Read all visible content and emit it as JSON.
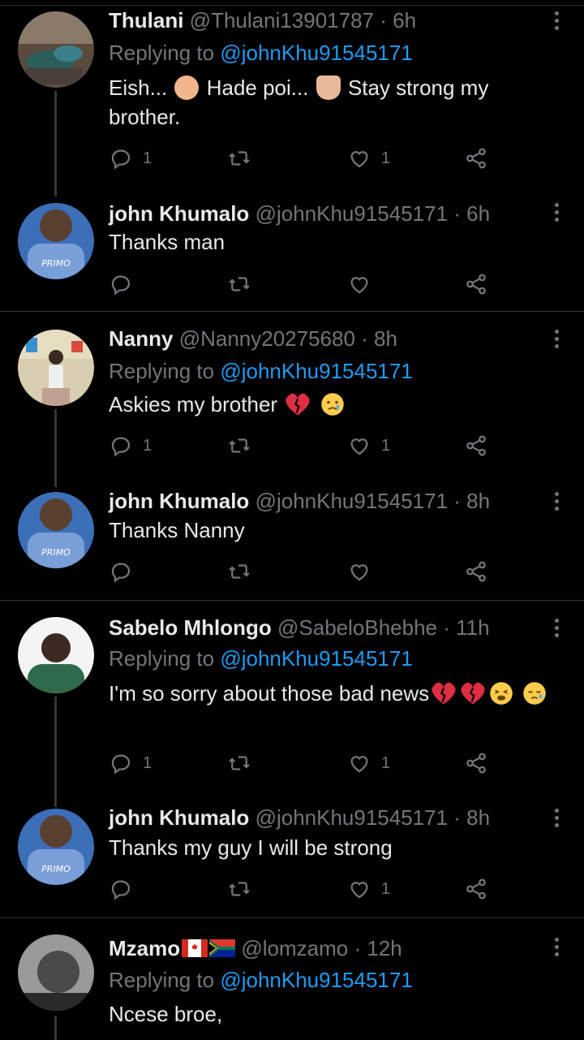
{
  "tweets": [
    {
      "name": "Thulani",
      "handle": "@Thulani13901787",
      "time": "· 6h",
      "replying_prefix": "Replying to",
      "mention": "@johnKhu91545171",
      "text_parts": [
        "Eish...",
        "Hade poi...",
        "Stay strong my brother."
      ],
      "emojis": [
        "facepalm-emoji",
        "folded-hands-emoji"
      ],
      "reply_count": "1",
      "retweet_count": "",
      "like_count": "1",
      "avatar": "thulani-avatar"
    },
    {
      "name": "john Khumalo",
      "handle": "@johnKhu91545171",
      "time": "· 6h",
      "text": "Thanks man",
      "reply_count": "",
      "retweet_count": "",
      "like_count": "",
      "avatar": "john-avatar"
    },
    {
      "name": "Nanny",
      "handle": "@Nanny20275680",
      "time": "· 8h",
      "replying_prefix": "Replying to",
      "mention": "@johnKhu91545171",
      "text": "Askies my brother",
      "emojis": [
        "broken-heart-emoji",
        "crying-face-emoji"
      ],
      "reply_count": "1",
      "retweet_count": "",
      "like_count": "1",
      "avatar": "nanny-avatar"
    },
    {
      "name": "john Khumalo",
      "handle": "@johnKhu91545171",
      "time": "· 8h",
      "text": "Thanks Nanny",
      "reply_count": "",
      "retweet_count": "",
      "like_count": "",
      "avatar": "john-avatar"
    },
    {
      "name": "Sabelo Mhlongo",
      "handle": "@SabeloBhebhe",
      "time": "· 11h",
      "replying_prefix": "Replying to",
      "mention": "@johnKhu91545171",
      "text": "I'm so sorry about those bad news",
      "emojis": [
        "broken-heart-emoji",
        "broken-heart-emoji",
        "tired-face-emoji",
        "sad-relieved-face-emoji"
      ],
      "reply_count": "1",
      "retweet_count": "",
      "like_count": "1",
      "avatar": "sabelo-avatar"
    },
    {
      "name": "john Khumalo",
      "handle": "@johnKhu91545171",
      "time": "· 8h",
      "text": "Thanks my guy I will be strong",
      "reply_count": "",
      "retweet_count": "",
      "like_count": "1",
      "avatar": "john-avatar"
    },
    {
      "name": "Mzamo",
      "handle": "@lomzamo",
      "time": "· 12h",
      "replying_prefix": "Replying to",
      "mention": "@johnKhu91545171",
      "text": "Ncese broe,",
      "flags": [
        "canada-flag",
        "south-africa-flag"
      ],
      "avatar": "mzamo-avatar"
    }
  ],
  "colors": {
    "background": "#000000",
    "text": "#e7e9ea",
    "secondary": "#71767b",
    "accent": "#1d9bf0",
    "divider": "#2f3336"
  }
}
